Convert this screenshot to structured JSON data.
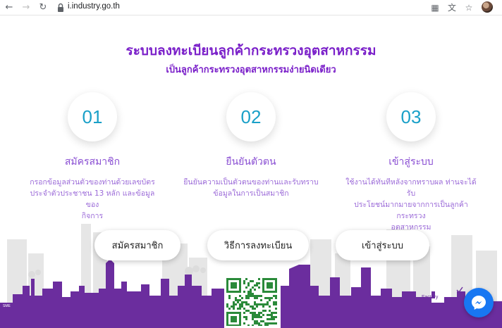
{
  "browser": {
    "url": "i.industry.go.th",
    "icons": [
      "back-arrow-icon",
      "forward-arrow-icon",
      "reload-icon",
      "lock-icon",
      "qr-code-icon",
      "translate-icon",
      "star-icon",
      "avatar"
    ]
  },
  "header": {
    "title": "ระบบลงทะเบียนลูกค้ากระทรวงอุตสาหกรรม",
    "subtitle": "เป็นลูกค้ากระทรวงอุตสาหกรรมง่ายนิดเดียว"
  },
  "steps": [
    {
      "number": "01",
      "title": "สมัครสมาชิก",
      "desc_lines": [
        "กรอกข้อมูลส่วนตัวของท่านด้วยเลขบัตร",
        "ประจำตัวประชาชน 13 หลัก และข้อมูลของ",
        "กิจการ"
      ]
    },
    {
      "number": "02",
      "title": "ยืนยันตัวตน",
      "desc_lines": [
        "ยืนยันความเป็นตัวตนของท่านและรับทราบ",
        "ข้อมูลในการเป็นสมาชิก"
      ]
    },
    {
      "number": "03",
      "title": "เข้าสู่ระบบ",
      "desc_lines": [
        "ใช้งานได้ทันทีหลังจากทราบผล ท่านจะได้รับ",
        "ประโยชน์มากมายจากการเป็นลูกค้ากระทรวง",
        "อุตสาหกรรม"
      ]
    }
  ],
  "buttons": {
    "register": "สมัครสมาชิก",
    "howto": "วิธีการลงทะเบียน",
    "login": "เข้าสู่ระบบ"
  },
  "skyline": {
    "label_factory": "Factory",
    "label_sme": "SME"
  },
  "colors": {
    "title_purple": "#7a1fc9",
    "number_teal": "#1aa0c8",
    "skyline_purple": "#6b2d9e",
    "skyline_grey": "#e4e4e4",
    "messenger_blue": "#1877f2"
  }
}
